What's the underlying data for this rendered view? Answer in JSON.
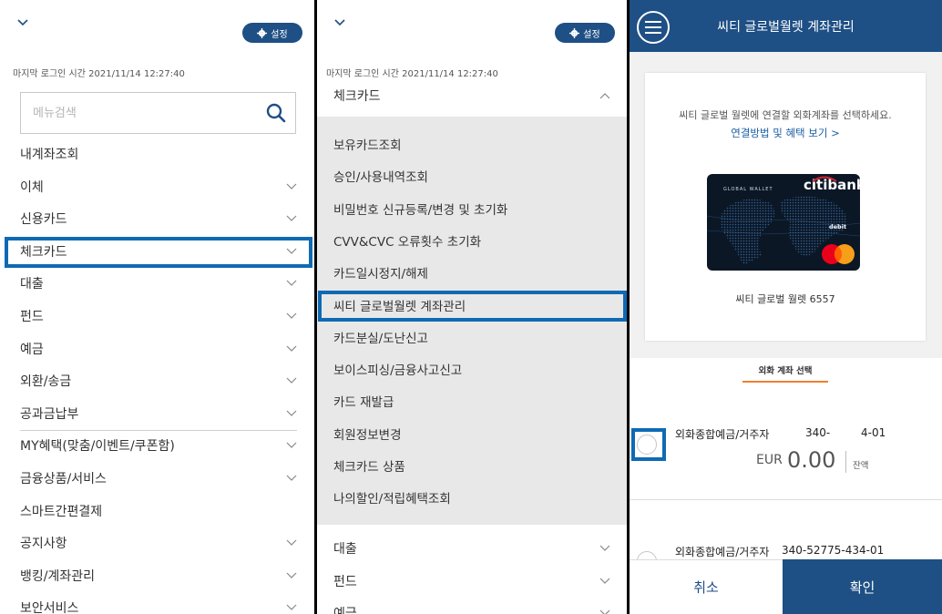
{
  "panel1": {
    "settings_label": "설정",
    "last_login": "마지막 로그인 시간 2021/11/14 12:27:40",
    "search_placeholder": "메뉴검색",
    "menu": [
      {
        "label": "내계좌조회",
        "chevron": false
      },
      {
        "label": "이체",
        "chevron": true
      },
      {
        "label": "신용카드",
        "chevron": true
      },
      {
        "label": "체크카드",
        "chevron": true
      },
      {
        "label": "대출",
        "chevron": true
      },
      {
        "label": "펀드",
        "chevron": true
      },
      {
        "label": "예금",
        "chevron": true
      },
      {
        "label": "외환/송금",
        "chevron": true
      },
      {
        "label": "공과금납부",
        "chevron": true
      },
      {
        "label": "MY혜택(맞춤/이벤트/쿠폰함)",
        "chevron": true
      },
      {
        "label": "금융상품/서비스",
        "chevron": true
      },
      {
        "label": "스마트간편결제",
        "chevron": false
      },
      {
        "label": "공지사항",
        "chevron": true
      },
      {
        "label": "뱅킹/계좌관리",
        "chevron": true
      },
      {
        "label": "보안서비스",
        "chevron": true
      }
    ]
  },
  "panel2": {
    "settings_label": "설정",
    "last_login": "마지막 로그인 시간 2021/11/14 12:27:40",
    "section_title": "체크카드",
    "submenu": [
      "보유카드조회",
      "승인/사용내역조회",
      "비밀번호 신규등록/변경 및 초기화",
      "CVV&CVC 오류횟수 초기화",
      "카드일시정지/해제",
      "씨티 글로벌월렛 계좌관리",
      "카드분실/도난신고",
      "보이스피싱/금융사고신고",
      "카드 재발급",
      "회원정보변경",
      "체크카드 상품",
      "나의할인/적립혜택조회"
    ],
    "menu": [
      "대출",
      "펀드",
      "예금"
    ]
  },
  "panel3": {
    "title": "씨티 글로벌월렛 계좌관리",
    "description": "씨티 글로벌 월렛에 연결할 외화계좌를 선택하세요.",
    "link": "연결방법 및 혜택 보기 >",
    "card": {
      "brand": "citibank",
      "wallet_text": "GLOBAL WALLET",
      "debit_text": "debit",
      "name": "씨티 글로벌 월렛 6557"
    },
    "tab_label": "외화 계좌 선택",
    "accounts": [
      {
        "name": "외화종합예금/거주자",
        "number_left": "340-",
        "number_right": "4-01",
        "currency": "EUR",
        "amount": "0.00",
        "balance_label": "잔액"
      },
      {
        "name": "외화종합예금/거주자",
        "number": "340-52775-434-01"
      }
    ],
    "cancel_label": "취소",
    "confirm_label": "확인"
  },
  "colors": {
    "navy": "#1e4f85",
    "highlight": "#0f6ab4",
    "tab_accent": "#f07f2d",
    "link": "#1d5fa5"
  }
}
